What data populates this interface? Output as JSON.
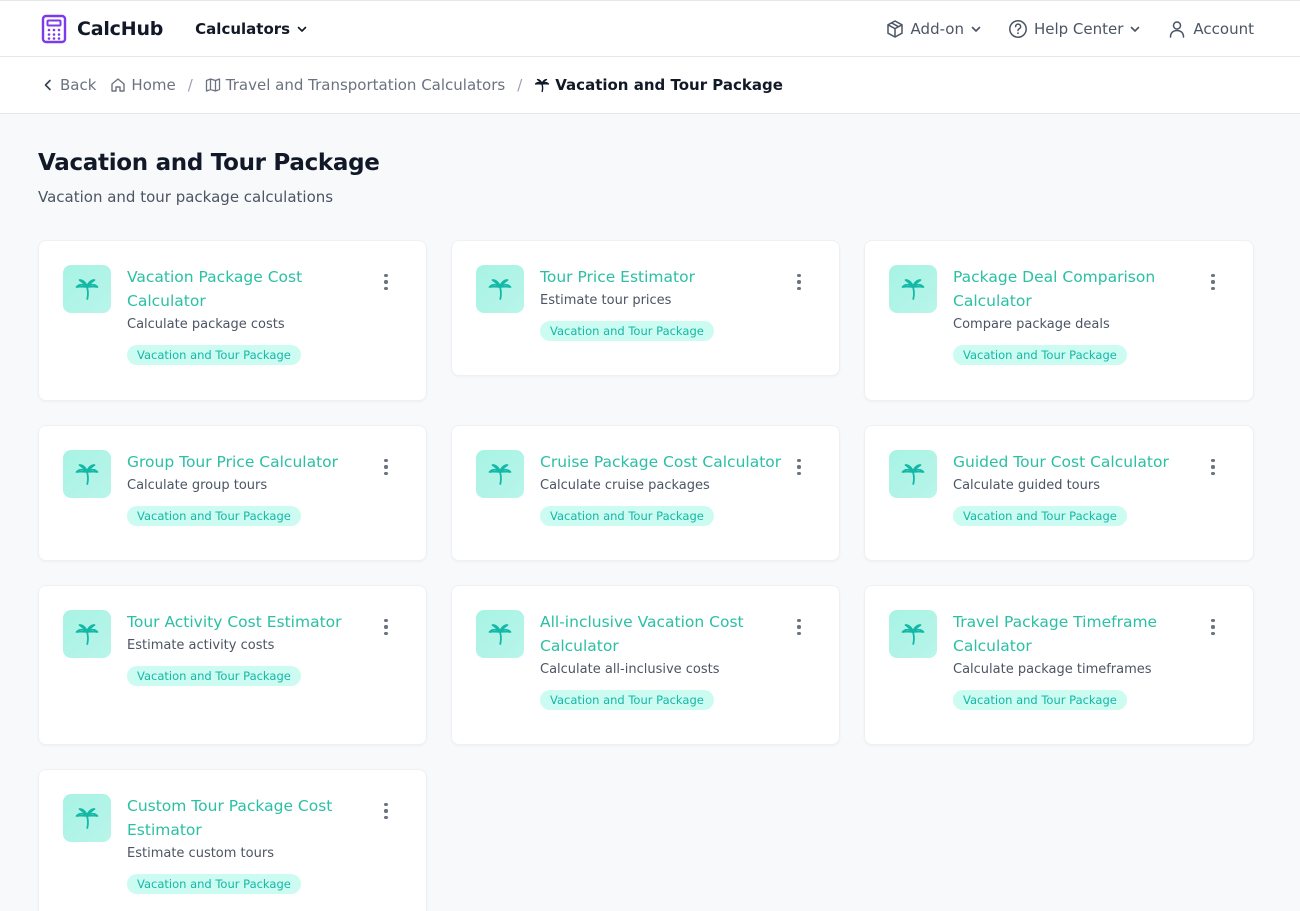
{
  "brand": {
    "name": "CalcHub"
  },
  "nav": {
    "calculators": "Calculators",
    "addon": "Add-on",
    "help": "Help Center",
    "account": "Account"
  },
  "breadcrumb": {
    "back": "Back",
    "home": "Home",
    "category": "Travel and Transportation Calculators",
    "current": "Vacation and Tour Package"
  },
  "page": {
    "title": "Vacation and Tour Package",
    "subtitle": "Vacation and tour package calculations"
  },
  "cards": [
    {
      "title": "Vacation Package Cost Calculator",
      "desc": "Calculate package costs",
      "tag": "Vacation and Tour Package"
    },
    {
      "title": "Tour Price Estimator",
      "desc": "Estimate tour prices",
      "tag": "Vacation and Tour Package"
    },
    {
      "title": "Package Deal Comparison Calculator",
      "desc": "Compare package deals",
      "tag": "Vacation and Tour Package"
    },
    {
      "title": "Group Tour Price Calculator",
      "desc": "Calculate group tours",
      "tag": "Vacation and Tour Package"
    },
    {
      "title": "Cruise Package Cost Calculator",
      "desc": "Calculate cruise packages",
      "tag": "Vacation and Tour Package"
    },
    {
      "title": "Guided Tour Cost Calculator",
      "desc": "Calculate guided tours",
      "tag": "Vacation and Tour Package"
    },
    {
      "title": "Tour Activity Cost Estimator",
      "desc": "Estimate activity costs",
      "tag": "Vacation and Tour Package"
    },
    {
      "title": "All-inclusive Vacation Cost Calculator",
      "desc": "Calculate all-inclusive costs",
      "tag": "Vacation and Tour Package"
    },
    {
      "title": "Travel Package Timeframe Calculator",
      "desc": "Calculate package timeframes",
      "tag": "Vacation and Tour Package"
    },
    {
      "title": "Custom Tour Package Cost Estimator",
      "desc": "Estimate custom tours",
      "tag": "Vacation and Tour Package"
    }
  ],
  "colors": {
    "accent": "#2bc0a5",
    "brand_icon": "#7c3aed",
    "tag_bg": "#ccfbf1"
  },
  "icons": {
    "brand": "calculator-icon",
    "card": "palm-tree-icon",
    "addon": "package-icon",
    "help": "help-circle-icon",
    "account": "user-icon"
  }
}
